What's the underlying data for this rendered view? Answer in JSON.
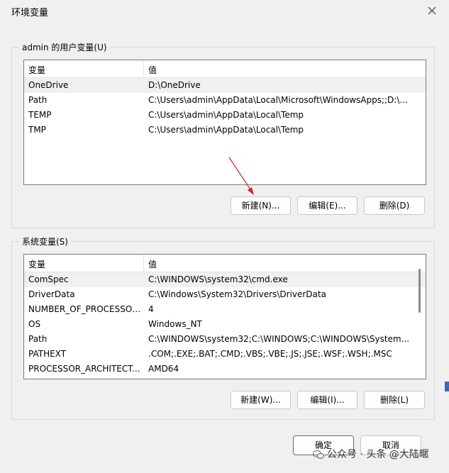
{
  "window": {
    "title": "环境变量"
  },
  "user_vars": {
    "legend": "admin 的用户变量(U)",
    "headers": {
      "name": "变量",
      "value": "值"
    },
    "rows": [
      {
        "name": "OneDrive",
        "value": "D:\\OneDrive"
      },
      {
        "name": "Path",
        "value": "C:\\Users\\admin\\AppData\\Local\\Microsoft\\WindowsApps;;D:\\..."
      },
      {
        "name": "TEMP",
        "value": "C:\\Users\\admin\\AppData\\Local\\Temp"
      },
      {
        "name": "TMP",
        "value": "C:\\Users\\admin\\AppData\\Local\\Temp"
      }
    ],
    "buttons": {
      "new": "新建(N)...",
      "edit": "编辑(E)...",
      "delete": "删除(D)"
    }
  },
  "system_vars": {
    "legend": "系统变量(S)",
    "headers": {
      "name": "变量",
      "value": "值"
    },
    "rows": [
      {
        "name": "ComSpec",
        "value": "C:\\WINDOWS\\system32\\cmd.exe"
      },
      {
        "name": "DriverData",
        "value": "C:\\Windows\\System32\\Drivers\\DriverData"
      },
      {
        "name": "NUMBER_OF_PROCESSORS",
        "value": "4"
      },
      {
        "name": "OS",
        "value": "Windows_NT"
      },
      {
        "name": "Path",
        "value": "C:\\WINDOWS\\system32;C:\\WINDOWS;C:\\WINDOWS\\System..."
      },
      {
        "name": "PATHEXT",
        "value": ".COM;.EXE;.BAT;.CMD;.VBS;.VBE;.JS;.JSE;.WSF;.WSH;.MSC"
      },
      {
        "name": "PROCESSOR_ARCHITECT...",
        "value": "AMD64"
      }
    ],
    "buttons": {
      "new": "新建(W)...",
      "edit": "编辑(I)...",
      "delete": "删除(L)"
    }
  },
  "footer": {
    "ok": "确定",
    "cancel": "取消"
  },
  "watermark": "公众号 · 头条 @大陆暱",
  "annotation_color": "#d22020"
}
